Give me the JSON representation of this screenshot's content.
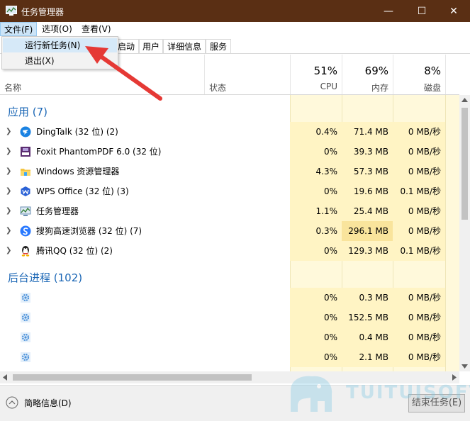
{
  "window": {
    "title": "任务管理器",
    "controls": {
      "minimize": "—",
      "maximize": "☐",
      "close": "✕"
    }
  },
  "menu": {
    "file": "文件(F)",
    "options": "选项(O)",
    "view": "查看(V)",
    "file_items": [
      {
        "label": "运行新任务(N)"
      },
      {
        "label": "退出(X)"
      }
    ]
  },
  "tabs": [
    {
      "label": "启动"
    },
    {
      "label": "用户"
    },
    {
      "label": "详细信息"
    },
    {
      "label": "服务"
    }
  ],
  "columns": {
    "name": "名称",
    "status": "状态",
    "cpu": {
      "percent": "51%",
      "label": "CPU"
    },
    "memory": {
      "percent": "69%",
      "label": "内存"
    },
    "disk": {
      "percent": "8%",
      "label": "磁盘"
    }
  },
  "groups": {
    "apps": "应用 (7)",
    "background": "后台进程 (102)"
  },
  "apps": [
    {
      "name": "DingTalk (32 位) (2)",
      "cpu": "0.4%",
      "mem": "71.4 MB",
      "disk": "0 MB/秒",
      "icon": "dingtalk-icon"
    },
    {
      "name": "Foxit PhantomPDF 6.0 (32 位)",
      "cpu": "0%",
      "mem": "39.3 MB",
      "disk": "0 MB/秒",
      "icon": "pdf-icon"
    },
    {
      "name": "Windows 资源管理器",
      "cpu": "4.3%",
      "mem": "57.3 MB",
      "disk": "0 MB/秒",
      "icon": "folder-icon"
    },
    {
      "name": "WPS Office (32 位) (3)",
      "cpu": "0%",
      "mem": "19.6 MB",
      "disk": "0.1 MB/秒",
      "icon": "wps-icon"
    },
    {
      "name": "任务管理器",
      "cpu": "1.1%",
      "mem": "25.4 MB",
      "disk": "0 MB/秒",
      "icon": "task-manager-icon"
    },
    {
      "name": "搜狗高速浏览器 (32 位) (7)",
      "cpu": "0.3%",
      "mem": "296.1 MB",
      "disk": "0 MB/秒",
      "icon": "sogou-icon"
    },
    {
      "name": "腾讯QQ (32 位) (2)",
      "cpu": "0%",
      "mem": "129.3 MB",
      "disk": "0.1 MB/秒",
      "icon": "qq-icon"
    }
  ],
  "background": [
    {
      "cpu": "0%",
      "mem": "0.3 MB",
      "disk": "0 MB/秒",
      "icon": "gear-icon"
    },
    {
      "cpu": "0%",
      "mem": "152.5 MB",
      "disk": "0 MB/秒",
      "icon": "gear-icon"
    },
    {
      "cpu": "0%",
      "mem": "0.4 MB",
      "disk": "0 MB/秒",
      "icon": "gear-icon"
    },
    {
      "cpu": "0%",
      "mem": "2.1 MB",
      "disk": "0 MB/秒",
      "icon": "gear-icon"
    }
  ],
  "footer": {
    "less_details": "简略信息(D)",
    "end_task": "结束任务(E)"
  },
  "watermark": "TUITUISOFT",
  "colors": {
    "titlebar": "#5a2f14",
    "group_text": "#1a66b5",
    "heat_low": "#fff4c4",
    "heat_mid": "#f9e49c",
    "arrow": "#e53935"
  }
}
